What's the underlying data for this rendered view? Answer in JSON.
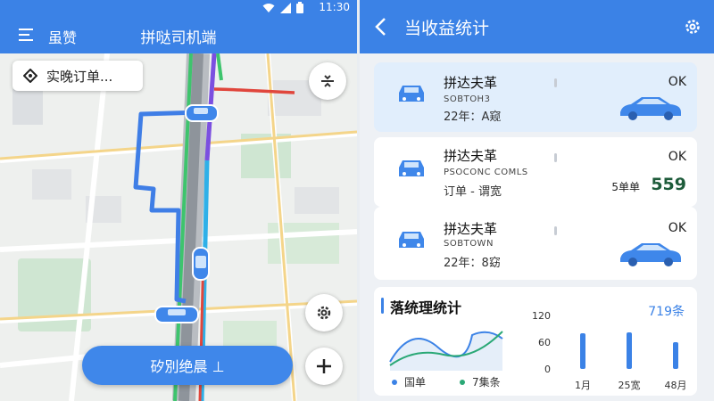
{
  "left": {
    "status_time": "11:30",
    "menu_label": "虽赞",
    "title": "拼哒司机端",
    "chip_label": "实晚订单...",
    "start_button": "矽別绝晨 ⊥"
  },
  "right": {
    "title": "当收益统计",
    "cards": [
      {
        "name": "拼达夫革",
        "sub": "SOBTOH3",
        "meta": "22年：A窥",
        "ok": "OK"
      },
      {
        "name": "拼达夫革",
        "sub": "PSOCONC COMLS",
        "meta": "订单 - 谓宽",
        "ok": "OK",
        "count": "5单单",
        "amount": "559"
      },
      {
        "name": "拼达夫革",
        "sub": "SOBTOWN",
        "meta": "22年：8窈",
        "ok": "OK"
      }
    ],
    "stats": {
      "title": "落统理统计",
      "total": "719条",
      "legend": [
        "国单",
        "7集条"
      ],
      "legend_colors": [
        "#3b82e6",
        "#2aa876"
      ],
      "yticks": [
        "120",
        "60",
        "0"
      ],
      "xticks": [
        "1月",
        "25宽",
        "48月"
      ],
      "bar_values": [
        80,
        82,
        60
      ],
      "bar_color": "#3b82e6"
    }
  }
}
